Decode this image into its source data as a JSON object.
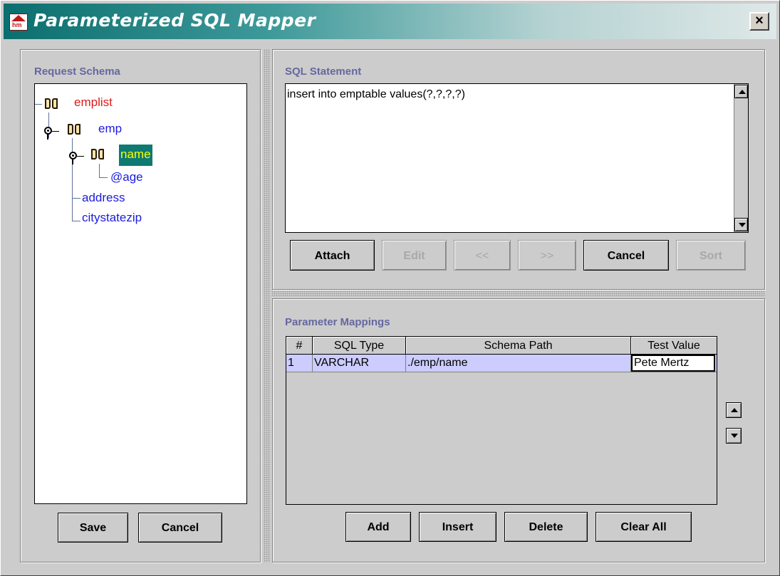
{
  "window": {
    "title": "Parameterized SQL Mapper",
    "close_label": "×",
    "icon": "app-logo-icon"
  },
  "request_schema": {
    "label": "Request Schema",
    "tree": [
      {
        "label": "emplist",
        "color": "#e01b1b",
        "icon": "book-icon"
      },
      {
        "label": "emp",
        "color": "#1b1be0",
        "icon": "book-icon"
      },
      {
        "label": "name",
        "color": "#ffff00",
        "selected": true,
        "icon": "book-icon"
      },
      {
        "label": "@age",
        "color": "#1b1be0"
      },
      {
        "label": "address",
        "color": "#1b1be0"
      },
      {
        "label": "citystatezip",
        "color": "#1b1be0"
      }
    ],
    "buttons": {
      "save": "Save",
      "cancel": "Cancel"
    }
  },
  "sql_statement": {
    "label": "SQL Statement",
    "text": "insert into emptable values(?,?,?,?)",
    "buttons": {
      "attach": "Attach",
      "edit": "Edit",
      "prev": "<<",
      "next": ">>",
      "cancel": "Cancel",
      "sort": "Sort"
    }
  },
  "parameter_mappings": {
    "label": "Parameter Mappings",
    "columns": [
      "#",
      "SQL Type",
      "Schema Path",
      "Test Value"
    ],
    "rows": [
      {
        "num": "1",
        "sql_type": "VARCHAR",
        "schema_path": "./emp/name",
        "test_value": "Pete Mertz"
      }
    ],
    "buttons": {
      "add": "Add",
      "insert": "Insert",
      "delete": "Delete",
      "clear_all": "Clear All"
    }
  },
  "colors": {
    "title_bar": "#0b6e6e",
    "section_label": "#6667a0",
    "selected_row": "#ccccff",
    "selected_node_bg": "#0e7a72"
  }
}
